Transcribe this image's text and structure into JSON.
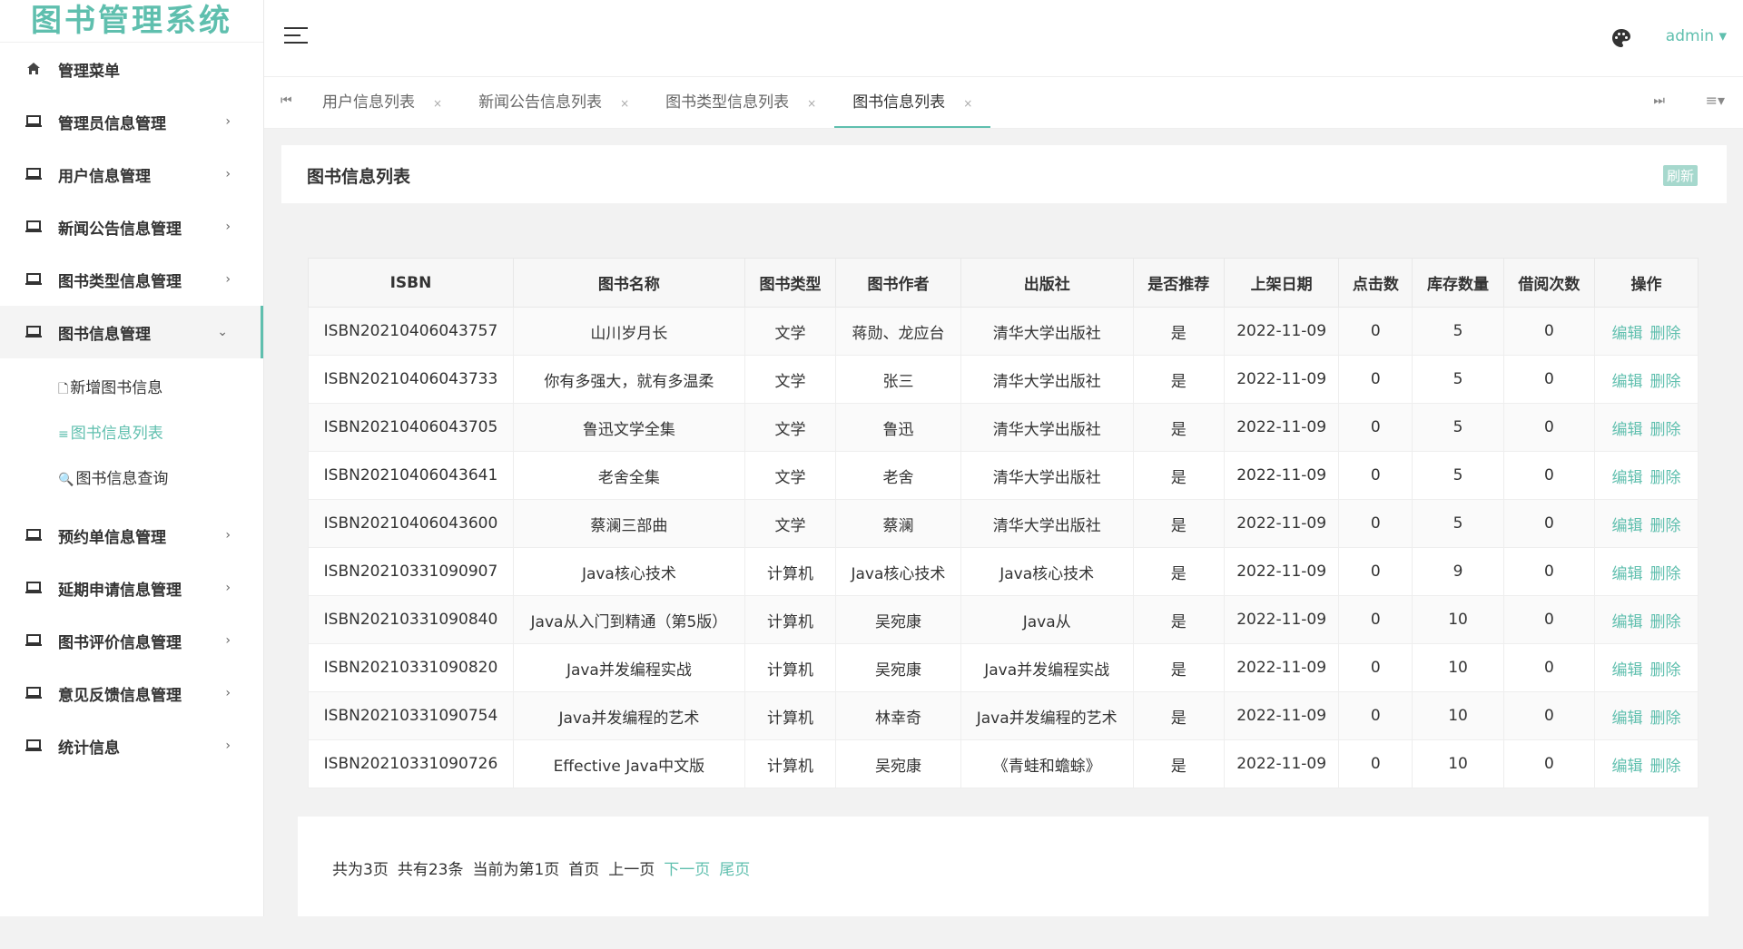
{
  "app": {
    "title": "图书管理系统"
  },
  "header": {
    "user": "admin ▾"
  },
  "sidebar": {
    "items": [
      {
        "label": "管理菜单",
        "icon": "home-icon",
        "arrow": ""
      },
      {
        "label": "管理员信息管理",
        "icon": "laptop-icon",
        "arrow": "›"
      },
      {
        "label": "用户信息管理",
        "icon": "laptop-icon",
        "arrow": "›"
      },
      {
        "label": "新闻公告信息管理",
        "icon": "laptop-icon",
        "arrow": "›"
      },
      {
        "label": "图书类型信息管理",
        "icon": "laptop-icon",
        "arrow": "›"
      },
      {
        "label": "图书信息管理",
        "icon": "laptop-icon",
        "arrow": "⌄"
      },
      {
        "label": "预约单信息管理",
        "icon": "laptop-icon",
        "arrow": "›"
      },
      {
        "label": "延期申请信息管理",
        "icon": "laptop-icon",
        "arrow": "›"
      },
      {
        "label": "图书评价信息管理",
        "icon": "laptop-icon",
        "arrow": "›"
      },
      {
        "label": "意见反馈信息管理",
        "icon": "laptop-icon",
        "arrow": "›"
      },
      {
        "label": "统计信息",
        "icon": "laptop-icon",
        "arrow": "›"
      }
    ],
    "submenu": [
      {
        "label": "新增图书信息",
        "icon": "🗋"
      },
      {
        "label": "图书信息列表",
        "icon": "≡"
      },
      {
        "label": "图书信息查询",
        "icon": "🔍"
      }
    ]
  },
  "tabs": {
    "prev": "⏮",
    "next": "⏭",
    "menu": "≡▾",
    "items": [
      {
        "label": "用户信息列表",
        "close": "×"
      },
      {
        "label": "新闻公告信息列表",
        "close": "×"
      },
      {
        "label": "图书类型信息列表",
        "close": "×"
      },
      {
        "label": "图书信息列表",
        "close": "×"
      }
    ]
  },
  "main": {
    "title": "图书信息列表",
    "refresh": "刷新",
    "table": {
      "headers": [
        "ISBN",
        "图书名称",
        "图书类型",
        "图书作者",
        "出版社",
        "是否推荐",
        "上架日期",
        "点击数",
        "库存数量",
        "借阅次数",
        "操作"
      ],
      "edit_label": "编辑",
      "delete_label": "删除",
      "rows": [
        [
          "ISBN20210406043757",
          "山川岁月长",
          "文学",
          "蒋勋、龙应台",
          "清华大学出版社",
          "是",
          "2022-11-09",
          "0",
          "5",
          "0"
        ],
        [
          "ISBN20210406043733",
          "你有多强大，就有多温柔",
          "文学",
          "张三",
          "清华大学出版社",
          "是",
          "2022-11-09",
          "0",
          "5",
          "0"
        ],
        [
          "ISBN20210406043705",
          "鲁迅文学全集",
          "文学",
          "鲁迅",
          "清华大学出版社",
          "是",
          "2022-11-09",
          "0",
          "5",
          "0"
        ],
        [
          "ISBN20210406043641",
          "老舍全集",
          "文学",
          "老舍",
          "清华大学出版社",
          "是",
          "2022-11-09",
          "0",
          "5",
          "0"
        ],
        [
          "ISBN20210406043600",
          "蔡澜三部曲",
          "文学",
          "蔡澜",
          "清华大学出版社",
          "是",
          "2022-11-09",
          "0",
          "5",
          "0"
        ],
        [
          "ISBN20210331090907",
          "Java核心技术",
          "计算机",
          "Java核心技术",
          "Java核心技术",
          "是",
          "2022-11-09",
          "0",
          "9",
          "0"
        ],
        [
          "ISBN20210331090840",
          "Java从入门到精通（第5版）",
          "计算机",
          "吴宛康",
          "Java从",
          "是",
          "2022-11-09",
          "0",
          "10",
          "0"
        ],
        [
          "ISBN20210331090820",
          "Java并发编程实战",
          "计算机",
          "吴宛康",
          "Java并发编程实战",
          "是",
          "2022-11-09",
          "0",
          "10",
          "0"
        ],
        [
          "ISBN20210331090754",
          "Java并发编程的艺术",
          "计算机",
          "林幸奇",
          "Java并发编程的艺术",
          "是",
          "2022-11-09",
          "0",
          "10",
          "0"
        ],
        [
          "ISBN20210331090726",
          "Effective Java中文版",
          "计算机",
          "吴宛康",
          "《青蛙和蟾蜍》",
          "是",
          "2022-11-09",
          "0",
          "10",
          "0"
        ]
      ]
    }
  },
  "pager": {
    "total_pages": "共为3页",
    "total_items": "共有23条",
    "current": "当前为第1页",
    "first": "首页",
    "prev": "上一页",
    "next": "下一页",
    "last": "尾页"
  },
  "colors": {
    "accent": "#5fbfae"
  }
}
